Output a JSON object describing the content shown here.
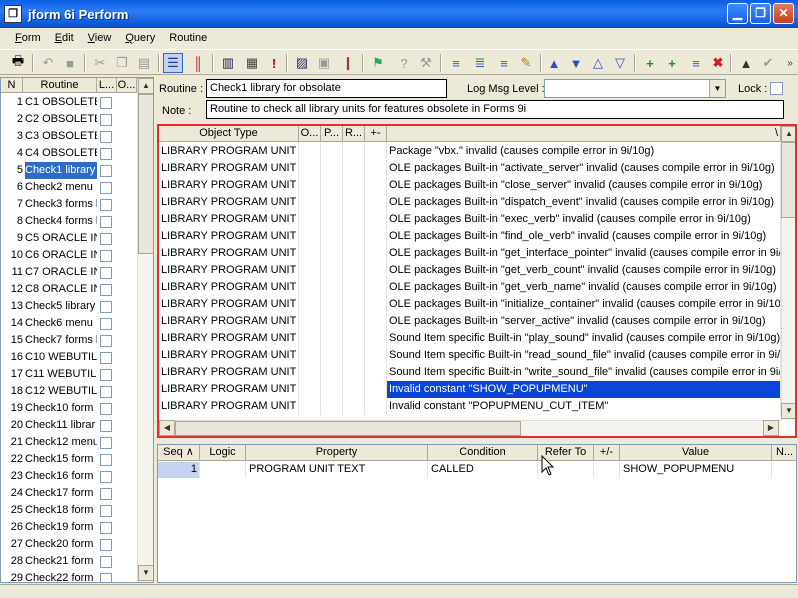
{
  "window": {
    "title": "jform 6i Perform",
    "icon": "app-icon"
  },
  "menu": [
    {
      "label": "Form",
      "ul": "F",
      "rest": "orm"
    },
    {
      "label": "Edit",
      "ul": "E",
      "rest": "dit"
    },
    {
      "label": "View",
      "ul": "V",
      "rest": "iew"
    },
    {
      "label": "Query",
      "ul": "Q",
      "rest": "uery"
    },
    {
      "label": "Routine",
      "ul": "",
      "rest": "Routine"
    }
  ],
  "left_list": {
    "headers": {
      "num": "N",
      "routine": "Routine",
      "l": "L...",
      "o": "O..."
    },
    "selected_index": 4,
    "rows": [
      {
        "n": "1",
        "name": "C1 OBSOLETE"
      },
      {
        "n": "2",
        "name": "C2 OBSOLETE"
      },
      {
        "n": "3",
        "name": "C3 OBSOLETE"
      },
      {
        "n": "4",
        "name": "C4 OBSOLETE"
      },
      {
        "n": "5",
        "name": "Check1 library"
      },
      {
        "n": "6",
        "name": "Check2 menu"
      },
      {
        "n": "7",
        "name": "Check3 forms l"
      },
      {
        "n": "8",
        "name": "Check4 forms l"
      },
      {
        "n": "9",
        "name": "C5 ORACLE IN"
      },
      {
        "n": "10",
        "name": "C6 ORACLE IN"
      },
      {
        "n": "11",
        "name": "C7 ORACLE IN"
      },
      {
        "n": "12",
        "name": "C8 ORACLE IN"
      },
      {
        "n": "13",
        "name": "Check5 library"
      },
      {
        "n": "14",
        "name": "Check6 menu"
      },
      {
        "n": "15",
        "name": "Check7 forms l"
      },
      {
        "n": "16",
        "name": "C10 WEBUTIL"
      },
      {
        "n": "17",
        "name": "C11 WEBUTIL"
      },
      {
        "n": "18",
        "name": "C12 WEBUTIL"
      },
      {
        "n": "19",
        "name": "Check10 form"
      },
      {
        "n": "20",
        "name": "Check11 librar"
      },
      {
        "n": "21",
        "name": "Check12 menu"
      },
      {
        "n": "22",
        "name": "Check15 form"
      },
      {
        "n": "23",
        "name": "Check16 form"
      },
      {
        "n": "24",
        "name": "Check17 form"
      },
      {
        "n": "25",
        "name": "Check18 form"
      },
      {
        "n": "26",
        "name": "Check19 form"
      },
      {
        "n": "27",
        "name": "Check20 form"
      },
      {
        "n": "28",
        "name": "Check21 form"
      },
      {
        "n": "29",
        "name": "Check22 form"
      }
    ]
  },
  "routine_form": {
    "routine_label": "Routine :",
    "routine_value": "Check1 library for obsolate",
    "log_label": "Log Msg Level :",
    "log_value": "",
    "lock_label": "Lock :",
    "note_label": "Note :",
    "note_value": "Routine to check all library units for features obsolete in Forms 9i"
  },
  "upper_grid": {
    "headers": {
      "type": "Object Type",
      "o": "O...",
      "p": "P...",
      "r": "R...",
      "pm": "+-",
      "last": "\\"
    },
    "selected_index": 14,
    "rows": [
      {
        "type": "LIBRARY PROGRAM UNIT",
        "desc": "Package \"vbx.\" invalid (causes compile error in 9i/10g)"
      },
      {
        "type": "LIBRARY PROGRAM UNIT",
        "desc": "OLE packages Built-in \"activate_server\" invalid (causes compile error in 9i/10g)"
      },
      {
        "type": "LIBRARY PROGRAM UNIT",
        "desc": "OLE packages Built-in \"close_server\" invalid (causes compile error in 9i/10g)"
      },
      {
        "type": "LIBRARY PROGRAM UNIT",
        "desc": "OLE packages Built-in \"dispatch_event\" invalid (causes compile error in 9i/10g)"
      },
      {
        "type": "LIBRARY PROGRAM UNIT",
        "desc": "OLE packages Built-in \"exec_verb\" invalid (causes compile error in 9i/10g)"
      },
      {
        "type": "LIBRARY PROGRAM UNIT",
        "desc": "OLE packages Built-in \"find_ole_verb\" invalid (causes compile error in 9i/10g)"
      },
      {
        "type": "LIBRARY PROGRAM UNIT",
        "desc": "OLE packages Built-in \"get_interface_pointer\" invalid (causes compile error in 9i/10"
      },
      {
        "type": "LIBRARY PROGRAM UNIT",
        "desc": "OLE packages Built-in \"get_verb_count\" invalid (causes compile error in 9i/10g)"
      },
      {
        "type": "LIBRARY PROGRAM UNIT",
        "desc": "OLE packages Built-in \"get_verb_name\" invalid (causes compile error in 9i/10g)"
      },
      {
        "type": "LIBRARY PROGRAM UNIT",
        "desc": "OLE packages Built-in \"initialize_container\" invalid (causes compile error in 9i/10g)"
      },
      {
        "type": "LIBRARY PROGRAM UNIT",
        "desc": "OLE packages Built-in \"server_active\" invalid (causes compile error in 9i/10g)"
      },
      {
        "type": "LIBRARY PROGRAM UNIT",
        "desc": "Sound Item specific Built-in \"play_sound\" invalid (causes compile error in 9i/10g)"
      },
      {
        "type": "LIBRARY PROGRAM UNIT",
        "desc": "Sound Item specific Built-in \"read_sound_file\" invalid (causes compile error in 9i/10g"
      },
      {
        "type": "LIBRARY PROGRAM UNIT",
        "desc": "Sound Item specific Built-in \"write_sound_file\" invalid (causes compile error in 9i/10"
      },
      {
        "type": "LIBRARY PROGRAM UNIT",
        "desc": "Invalid constant  \"SHOW_POPUPMENU\""
      },
      {
        "type": "LIBRARY PROGRAM UNIT",
        "desc": "Invalid constant  \"POPUPMENU_CUT_ITEM\""
      }
    ]
  },
  "lower_grid": {
    "headers": {
      "seq": "Seq",
      "logic": "Logic",
      "property": "Property",
      "condition": "Condition",
      "refer": "Refer To",
      "pm": "+/-",
      "value": "Value",
      "n": "N..."
    },
    "rows": [
      {
        "seq": "1",
        "logic": "",
        "property": "PROGRAM UNIT TEXT",
        "condition": "CALLED",
        "refer": "",
        "pm": "",
        "value": "SHOW_POPUPMENU",
        "n": ""
      }
    ]
  }
}
